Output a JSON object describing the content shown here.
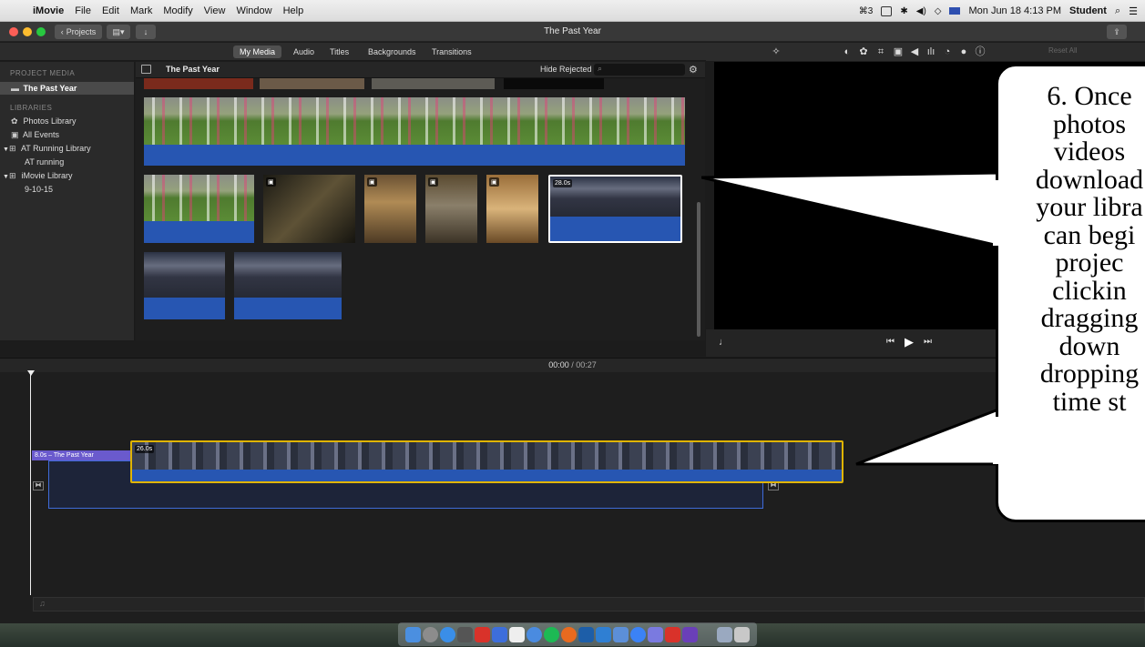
{
  "menubar": {
    "app_name": "iMovie",
    "menus": [
      "File",
      "Edit",
      "Mark",
      "Modify",
      "View",
      "Window",
      "Help"
    ],
    "status_badge": "3",
    "datetime": "Mon Jun 18  4:13 PM",
    "user": "Student"
  },
  "toolbar": {
    "projects_label": "Projects",
    "window_title": "The Past Year"
  },
  "media_tabs": [
    "My Media",
    "Audio",
    "Titles",
    "Backgrounds",
    "Transitions"
  ],
  "viewer_toolbar": {
    "reset_label": "Reset All"
  },
  "sidebar": {
    "project_media_header": "PROJECT MEDIA",
    "project_item": "The Past Year",
    "libraries_header": "LIBRARIES",
    "items": [
      "Photos Library",
      "All Events",
      "AT Running Library",
      "AT running",
      "iMovie Library",
      "9-10-15"
    ]
  },
  "browser": {
    "title": "The Past Year",
    "filter_label": "Hide Rejected",
    "clip_duration_badge": "28.0s"
  },
  "timeline": {
    "timecode_current": "00:00",
    "timecode_total": "00:27",
    "title_clip_label": "8.0s – The Past Year",
    "main_clip_badge": "26.0s"
  },
  "callout": {
    "lines": [
      "6. Once",
      "photos",
      "videos",
      "download",
      "your libra",
      "can begi",
      "projec",
      "clickin",
      "dragging",
      "down",
      "dropping",
      "time st"
    ]
  },
  "colors": {
    "accent_yellow": "#e0b400",
    "audio_blue": "#2756b2",
    "title_purple": "#6a5acd"
  }
}
